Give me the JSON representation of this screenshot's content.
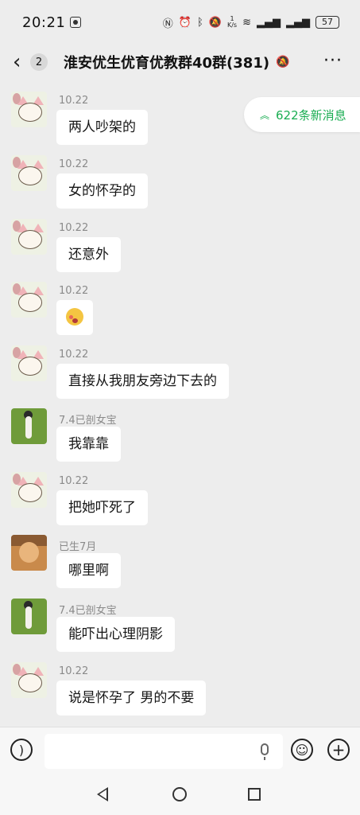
{
  "status_bar": {
    "time": "20:21",
    "speed_top": "1",
    "speed_bottom": "K/s",
    "battery": "57"
  },
  "header": {
    "back_count": "2",
    "title": "淮安优生优育优教群40群(381)",
    "more": "···"
  },
  "new_messages": {
    "label": "622条新消息"
  },
  "messages": [
    {
      "sender": "10.22",
      "text": "两人吵架的",
      "avatar": "cat-avatar"
    },
    {
      "sender": "10.22",
      "text": "女的怀孕的",
      "avatar": "cat-avatar"
    },
    {
      "sender": "10.22",
      "text": "还意外",
      "avatar": "cat-avatar"
    },
    {
      "sender": "10.22",
      "text": "",
      "avatar": "cat-avatar",
      "emoji": "flushed-face-emoji"
    },
    {
      "sender": "10.22",
      "text": "直接从我朋友旁边下去的",
      "avatar": "cat-avatar"
    },
    {
      "sender": "7.4已剖女宝",
      "text": "我靠靠",
      "avatar": "player-avatar"
    },
    {
      "sender": "10.22",
      "text": "把她吓死了",
      "avatar": "cat-avatar"
    },
    {
      "sender": "已生7月",
      "text": "哪里啊",
      "avatar": "dog-avatar"
    },
    {
      "sender": "7.4已剖女宝",
      "text": "能吓出心理阴影",
      "avatar": "player-avatar"
    },
    {
      "sender": "10.22",
      "text": "说是怀孕了 男的不要",
      "avatar": "cat-avatar"
    }
  ],
  "input_bar": {
    "placeholder": ""
  },
  "icons": [
    "voice-icon",
    "mic-icon",
    "emoji-icon",
    "plus-icon",
    "nav-back-icon",
    "nav-home-icon",
    "nav-recent-icon"
  ]
}
